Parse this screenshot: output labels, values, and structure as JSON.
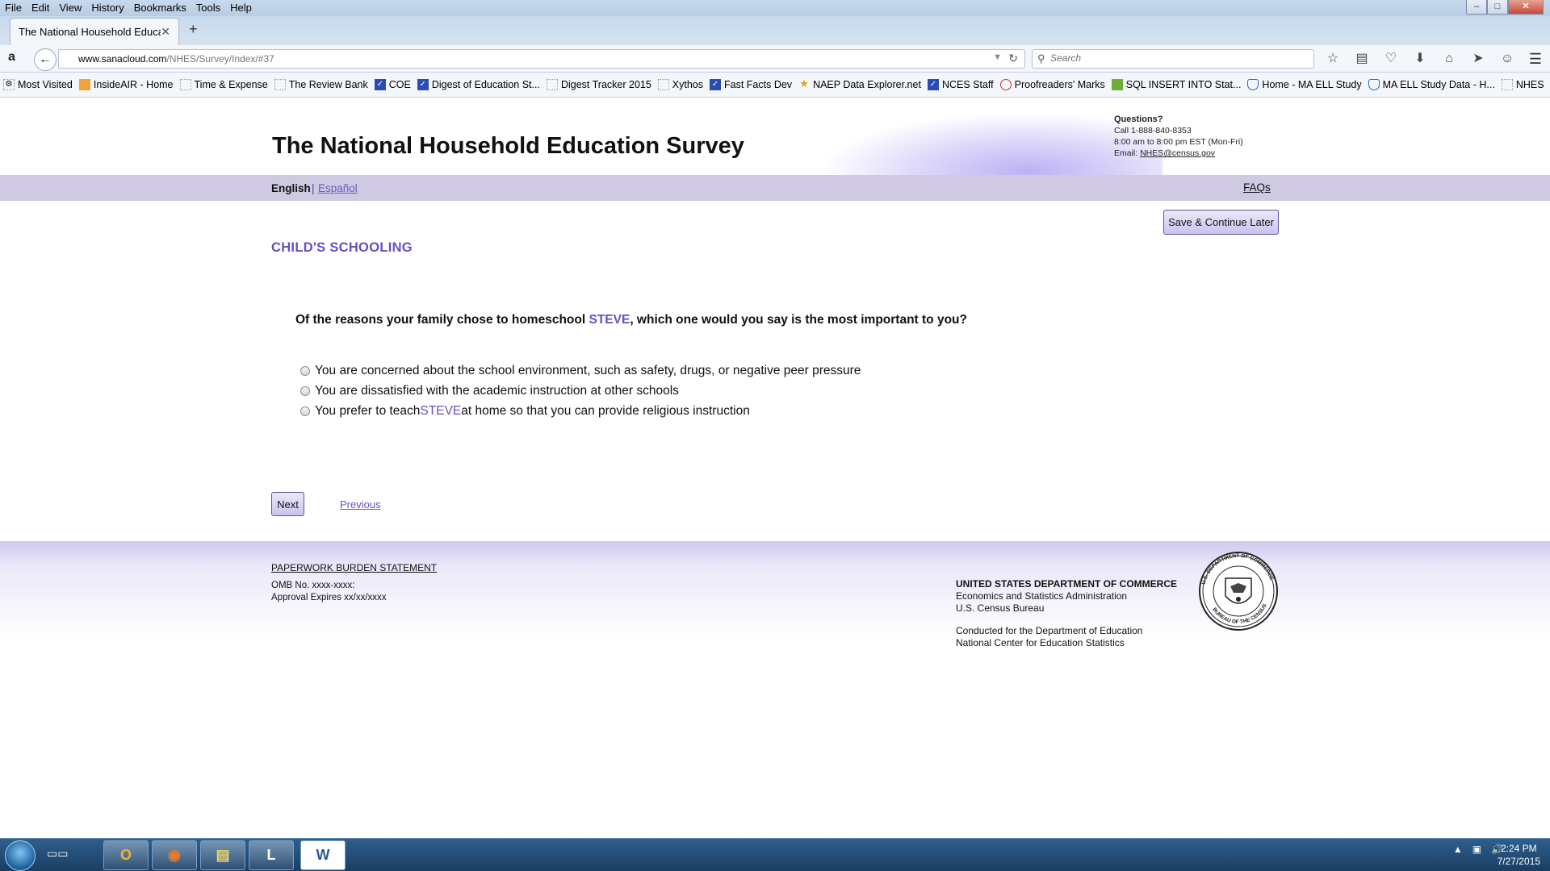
{
  "browser": {
    "menu": [
      "File",
      "Edit",
      "View",
      "History",
      "Bookmarks",
      "Tools",
      "Help"
    ],
    "tab_title": "The National Household Educa...",
    "url_domain": "www.sanacloud.com",
    "url_path": "/NHES/Survey/Index/#37",
    "search_placeholder": "Search",
    "bookmarks": [
      {
        "label": "Most Visited",
        "icon": "gear-icon"
      },
      {
        "label": "InsideAIR - Home",
        "icon": "grid-icon"
      },
      {
        "label": "Time & Expense",
        "icon": "page-icon"
      },
      {
        "label": "The Review Bank",
        "icon": "page-icon"
      },
      {
        "label": "COE",
        "icon": "nces-icon"
      },
      {
        "label": "Digest of Education St...",
        "icon": "nces-icon"
      },
      {
        "label": "Digest Tracker 2015",
        "icon": "page-icon"
      },
      {
        "label": "Xythos",
        "icon": "page-icon"
      },
      {
        "label": "Fast Facts Dev",
        "icon": "nces-icon"
      },
      {
        "label": "NAEP Data Explorer.net",
        "icon": "star-icon"
      },
      {
        "label": "NCES Staff",
        "icon": "nces-icon"
      },
      {
        "label": "Proofreaders' Marks",
        "icon": "no-icon"
      },
      {
        "label": "SQL INSERT INTO Stat...",
        "icon": "sql-icon"
      },
      {
        "label": "Home - MA ELL Study",
        "icon": "shield-icon"
      },
      {
        "label": "MA ELL Study Data - H...",
        "icon": "shield-icon"
      },
      {
        "label": "NHES",
        "icon": "page-icon"
      }
    ]
  },
  "site": {
    "title": "The National Household Education Survey",
    "questions_title": "Questions?",
    "questions_phone": "Call 1-888-840-8353",
    "questions_hours": "8:00 am to 8:00 pm EST (Mon-Fri)",
    "questions_email_label": "Email: ",
    "questions_email": "NHES@census.gov",
    "lang_english": "English",
    "lang_sep": "|",
    "lang_espanol": "Español",
    "faqs": "FAQs",
    "save_button": "Save & Continue Later"
  },
  "survey": {
    "section_title": "CHILD'S SCHOOLING",
    "question_prefix": "Of the reasons your family chose to homeschool ",
    "child_name": "STEVE",
    "question_suffix": ", which one would you say is the most important to you?",
    "options": [
      {
        "text": "You are concerned about the school environment, such as safety, drugs, or negative peer pressure"
      },
      {
        "text": "You are dissatisfied with the academic instruction at other schools"
      },
      {
        "prefix": "You prefer to teach ",
        "name": "STEVE",
        "suffix": " at home so that you can provide religious instruction"
      }
    ],
    "next_button": "Next",
    "previous_link": "Previous"
  },
  "footer": {
    "burden_link": "PAPERWORK BURDEN STATEMENT",
    "omb": "OMB No. xxxx-xxxx:",
    "approval": "Approval Expires xx/xx/xxxx",
    "dept_line1": "UNITED STATES DEPARTMENT OF COMMERCE",
    "dept_line2": "Economics and Statistics Administration",
    "dept_line3": "U.S. Census Bureau",
    "conducted_line1": "Conducted for the Department of Education",
    "conducted_line2": "National Center for Education Statistics",
    "seal_top_text": "U.S. DEPARTMENT OF COMMERCE",
    "seal_bottom_text": "BUREAU OF THE CENSUS"
  },
  "taskbar": {
    "apps": [
      {
        "name": "outlook-icon",
        "glyph": "O"
      },
      {
        "name": "firefox-icon",
        "glyph": "◉"
      },
      {
        "name": "explorer-icon",
        "glyph": "▤"
      },
      {
        "name": "lync-icon",
        "glyph": "L"
      },
      {
        "name": "word-icon",
        "glyph": "W"
      }
    ],
    "time": "2:24 PM",
    "date": "7/27/2015"
  },
  "colors": {
    "accent_purple": "#5f52c2",
    "lang_bar": "#cfc9e2"
  }
}
